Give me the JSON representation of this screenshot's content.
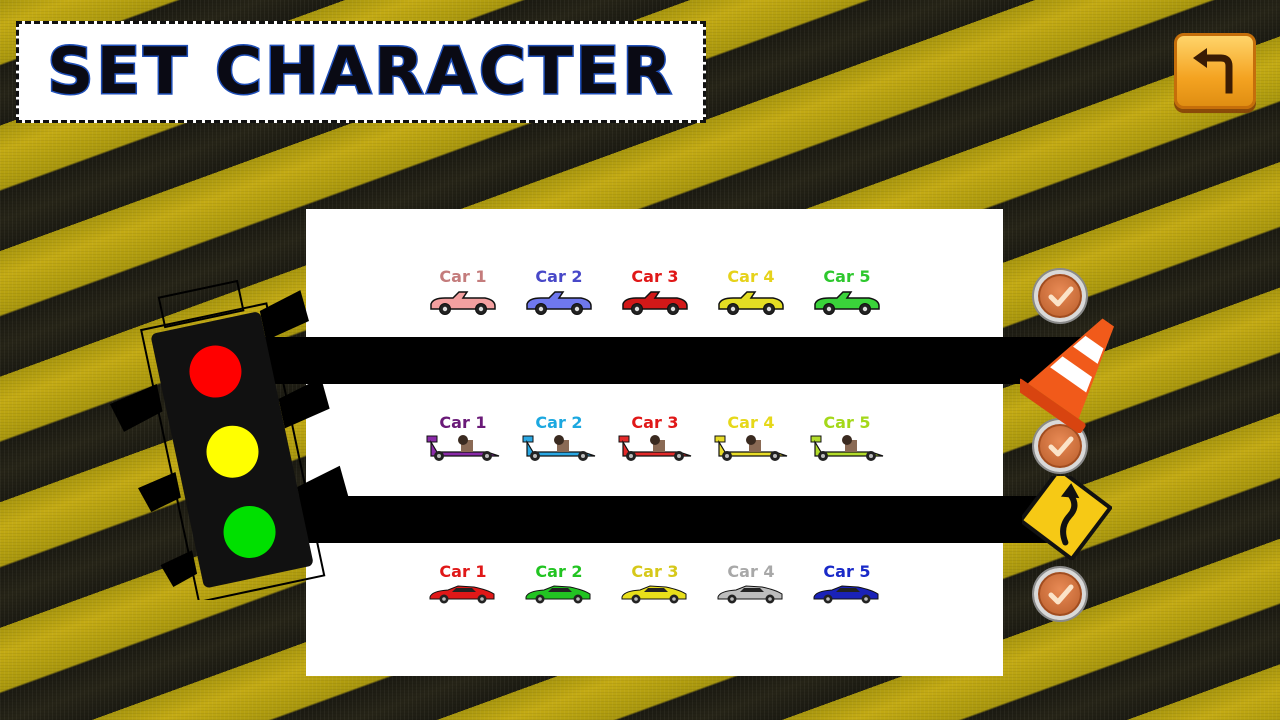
{
  "title": "SET CHARACTER",
  "back_button": {
    "icon": "back-arrow-icon"
  },
  "rows": [
    {
      "type": "convertible",
      "cars": [
        {
          "label": "Car 1",
          "label_color": "#c47c7c",
          "body_color": "#f4a0a0"
        },
        {
          "label": "Car 2",
          "label_color": "#4848c8",
          "body_color": "#6f78ee"
        },
        {
          "label": "Car 3",
          "label_color": "#e01818",
          "body_color": "#d21818"
        },
        {
          "label": "Car 4",
          "label_color": "#e6d21a",
          "body_color": "#e4dd23"
        },
        {
          "label": "Car 5",
          "label_color": "#2ec82e",
          "body_color": "#3ad33a"
        }
      ]
    },
    {
      "type": "formula",
      "cars": [
        {
          "label": "Car 1",
          "label_color": "#6a1a78",
          "body_color": "#8a2aa8"
        },
        {
          "label": "Car 2",
          "label_color": "#1ca8e0",
          "body_color": "#2aa8e4"
        },
        {
          "label": "Car 3",
          "label_color": "#e01818",
          "body_color": "#e42a2a"
        },
        {
          "label": "Car 4",
          "label_color": "#e6d81a",
          "body_color": "#e8dc28"
        },
        {
          "label": "Car 5",
          "label_color": "#a4d81a",
          "body_color": "#b2dc2a"
        }
      ]
    },
    {
      "type": "sports",
      "cars": [
        {
          "label": "Car 1",
          "label_color": "#e01818",
          "body_color": "#e01818"
        },
        {
          "label": "Car 2",
          "label_color": "#22c422",
          "body_color": "#22c422"
        },
        {
          "label": "Car 3",
          "label_color": "#d6c81a",
          "body_color": "#e8df1a"
        },
        {
          "label": "Car 4",
          "label_color": "#a8a8a8",
          "body_color": "#bdbdbd"
        },
        {
          "label": "Car 5",
          "label_color": "#1a2ac8",
          "body_color": "#1a22b8"
        }
      ]
    }
  ],
  "checkboxes": [
    {
      "icon": "checkmark-icon",
      "checked": true
    },
    {
      "icon": "checkmark-icon",
      "checked": true
    },
    {
      "icon": "checkmark-icon",
      "checked": true
    }
  ],
  "decor": {
    "traffic_light": "traffic-light-icon",
    "cone": "traffic-cone-icon",
    "sign": "curve-road-sign-icon"
  }
}
